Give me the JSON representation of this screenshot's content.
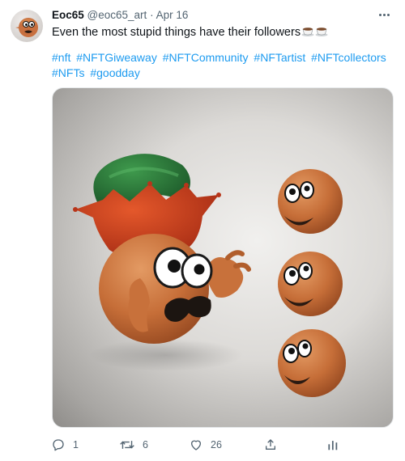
{
  "tweet": {
    "display_name": "Eoc65",
    "handle": "@eoc65_art",
    "separator": "·",
    "date": "Apr 16",
    "text": "Even the most stupid things have their followers",
    "hashtags": [
      "#nft",
      "#NFTGiweaway",
      "#NFTCommunity",
      "#NFTartist",
      "#NFTcollectors",
      "#NFTs",
      "#goodday"
    ]
  },
  "actions": {
    "reply_count": "1",
    "retweet_count": "6",
    "like_count": "26"
  },
  "icons": {
    "more": "more-horizontal-icon",
    "reply": "speech-bubble-icon",
    "retweet": "retweet-arrows-icon",
    "like": "heart-icon",
    "share": "share-upload-icon",
    "analytics": "bar-chart-icon",
    "emoji": "coffee-cup-emoji"
  },
  "colors": {
    "link": "#1d9bf0",
    "secondary_text": "#536471",
    "primary_text": "#0f1419"
  }
}
